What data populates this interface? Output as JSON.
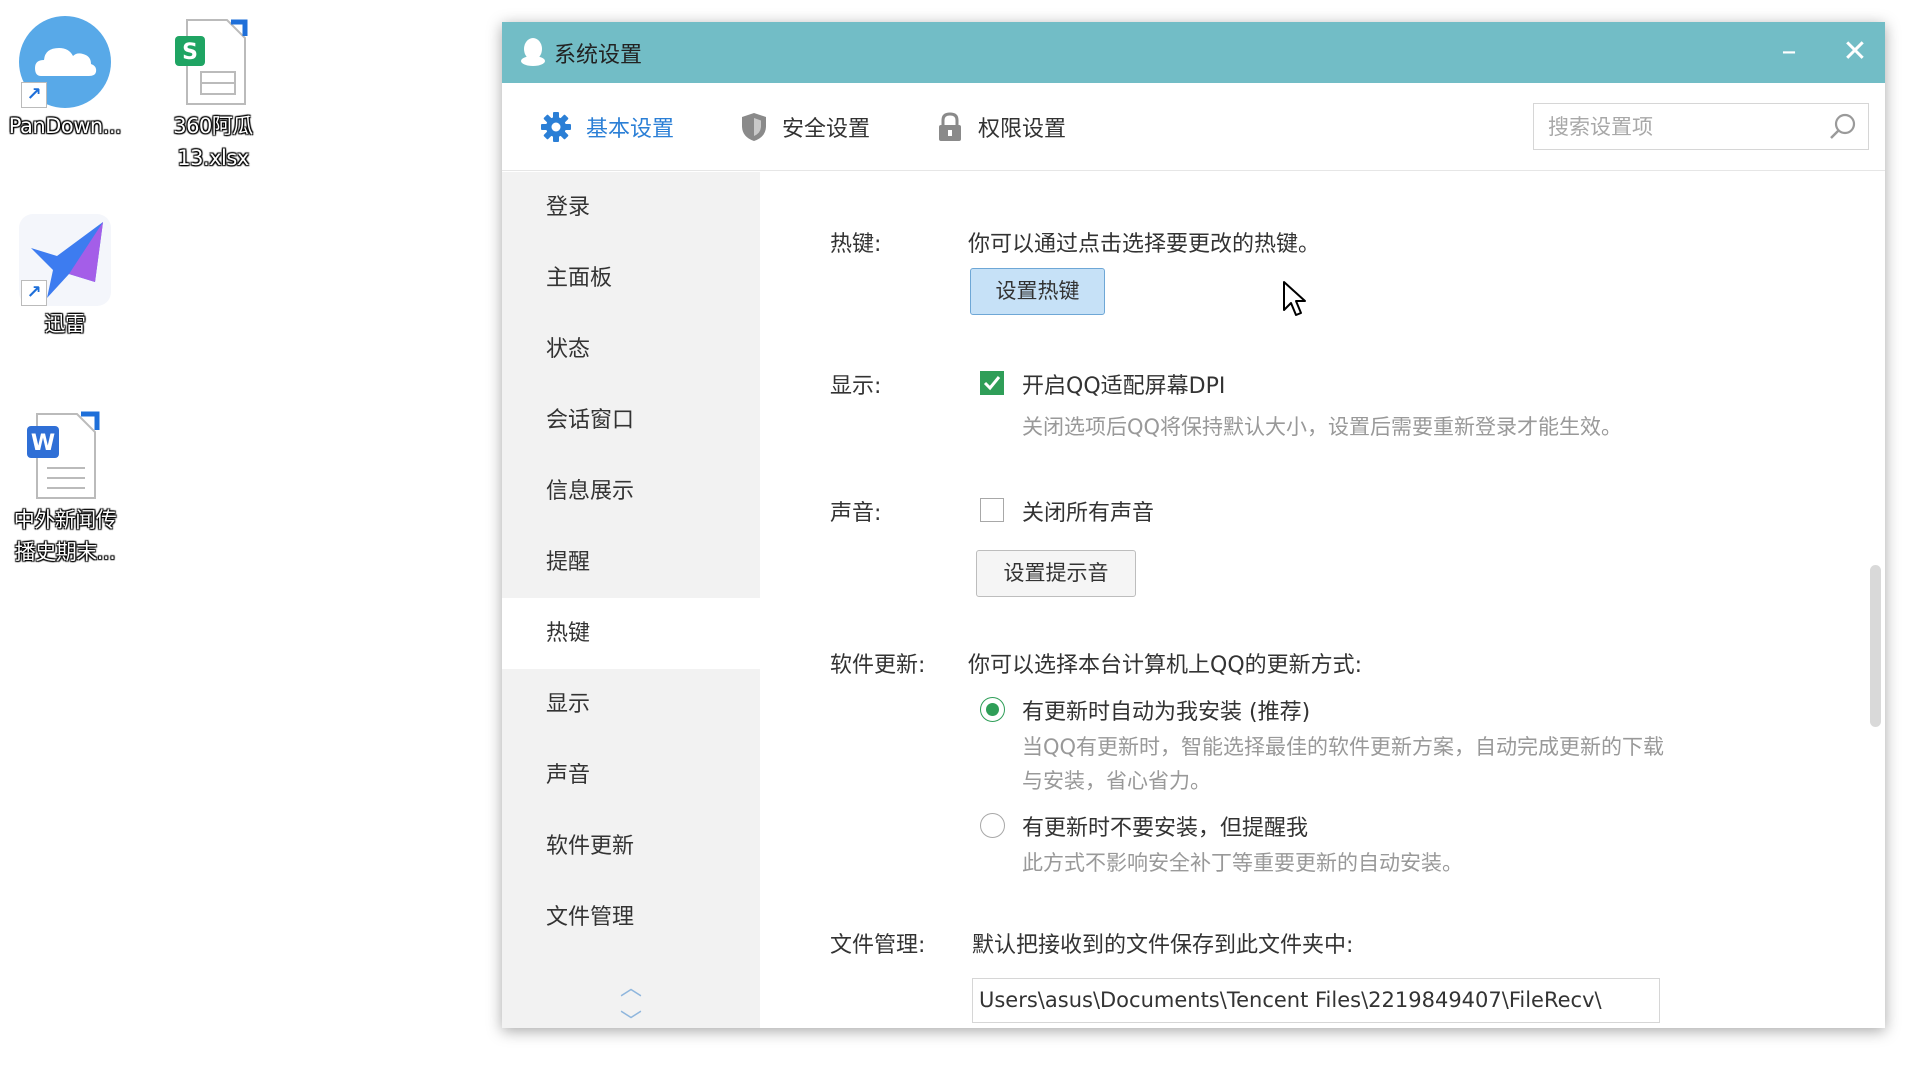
{
  "desktop": {
    "icons": [
      {
        "label": "PanDown...",
        "icon": "cloud-icon"
      },
      {
        "label": "360阿瓜\n13.xlsx",
        "icon": "spreadsheet-icon"
      },
      {
        "label": "迅雷",
        "icon": "thunder-bird-icon"
      },
      {
        "label": "中外新闻传\n播史期末...",
        "icon": "word-doc-icon"
      }
    ]
  },
  "window": {
    "title": "系统设置",
    "accent": "#72bdc6",
    "minimize": "–",
    "close": "✕"
  },
  "tabs": [
    {
      "label": "基本设置",
      "icon": "gear-icon",
      "active": true
    },
    {
      "label": "安全设置",
      "icon": "shield-icon",
      "active": false
    },
    {
      "label": "权限设置",
      "icon": "lock-icon",
      "active": false
    }
  ],
  "search": {
    "placeholder": "搜索设置项",
    "value": ""
  },
  "sidebar": {
    "items": [
      {
        "label": "登录"
      },
      {
        "label": "主面板"
      },
      {
        "label": "状态"
      },
      {
        "label": "会话窗口"
      },
      {
        "label": "信息展示"
      },
      {
        "label": "提醒"
      },
      {
        "label": "热键",
        "active": true
      },
      {
        "label": "显示"
      },
      {
        "label": "声音"
      },
      {
        "label": "软件更新"
      },
      {
        "label": "文件管理"
      }
    ],
    "scroll_up": "︿",
    "scroll_down": "﹀"
  },
  "settings": {
    "hotkey": {
      "label": "热键:",
      "description": "你可以通过点击选择要更改的热键。",
      "button": "设置热键"
    },
    "display": {
      "label": "显示:",
      "checkbox_label": "开启QQ适配屏幕DPI",
      "checked": true,
      "hint": "关闭选项后QQ将保持默认大小，设置后需要重新登录才能生效。"
    },
    "sound": {
      "label": "声音:",
      "checkbox_label": "关闭所有声音",
      "checked": false,
      "button": "设置提示音"
    },
    "update": {
      "label": "软件更新:",
      "description": "你可以选择本台计算机上QQ的更新方式:",
      "options": [
        {
          "label": "有更新时自动为我安装 (推荐)",
          "hint_line1": "当QQ有更新时，智能选择最佳的软件更新方案，自动完成更新的下载",
          "hint_line2": "与安装，省心省力。",
          "selected": true
        },
        {
          "label": "有更新时不要安装，但提醒我",
          "hint_line1": "此方式不影响安全补丁等重要更新的自动安装。",
          "selected": false
        }
      ]
    },
    "file": {
      "label": "文件管理:",
      "description": "默认把接收到的文件保存到此文件夹中:",
      "path": "Users\\asus\\Documents\\Tencent Files\\2219849407\\FileRecv\\"
    }
  }
}
